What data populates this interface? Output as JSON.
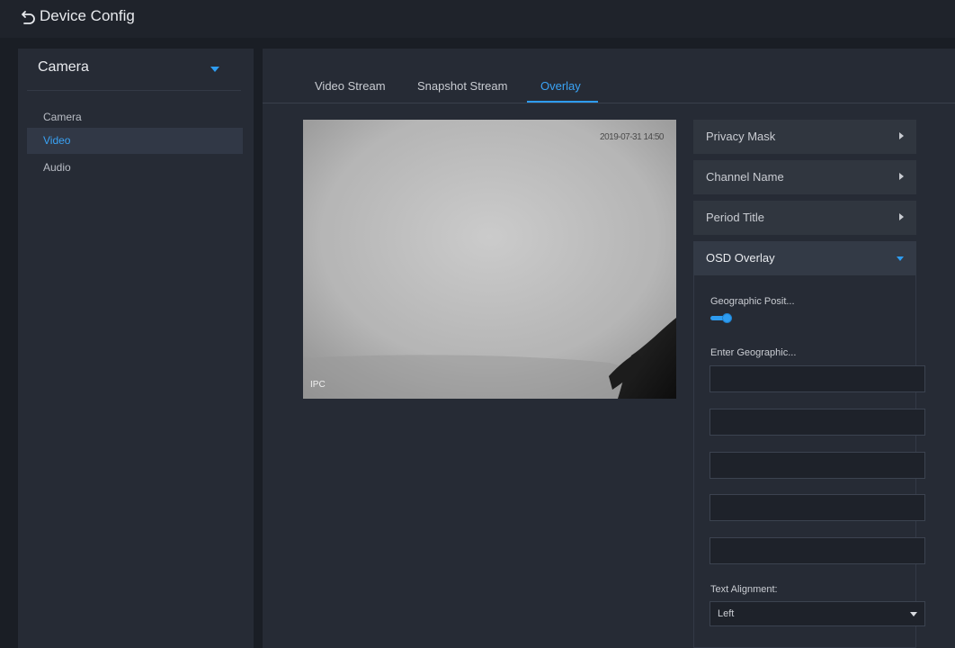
{
  "header": {
    "title": "Device Config",
    "back_icon": "undo-arrow-icon"
  },
  "sidebar": {
    "group_label": "Camera",
    "items": [
      {
        "label": "Camera",
        "active": false
      },
      {
        "label": "Video",
        "active": true
      },
      {
        "label": "Audio",
        "active": false
      }
    ]
  },
  "tabs": [
    {
      "label": "Video Stream",
      "active": false
    },
    {
      "label": "Snapshot Stream",
      "active": false
    },
    {
      "label": "Overlay",
      "active": true
    }
  ],
  "preview": {
    "timestamp": "2019-07-31 14:50",
    "channel_label": "IPC"
  },
  "panels": [
    {
      "label": "Privacy Mask",
      "expanded": false
    },
    {
      "label": "Channel Name",
      "expanded": false
    },
    {
      "label": "Period Title",
      "expanded": false
    },
    {
      "label": "OSD Overlay",
      "expanded": true
    }
  ],
  "osd": {
    "geo_label": "Geographic Posit...",
    "geo_enabled": true,
    "enter_label": "Enter Geographic...",
    "fields": [
      "",
      "",
      "",
      "",
      ""
    ],
    "alignment_label": "Text Alignment:",
    "alignment_value": "Left"
  },
  "colors": {
    "accent": "#2e9cf0",
    "background": "#1a1e25",
    "panel": "#262b35"
  }
}
